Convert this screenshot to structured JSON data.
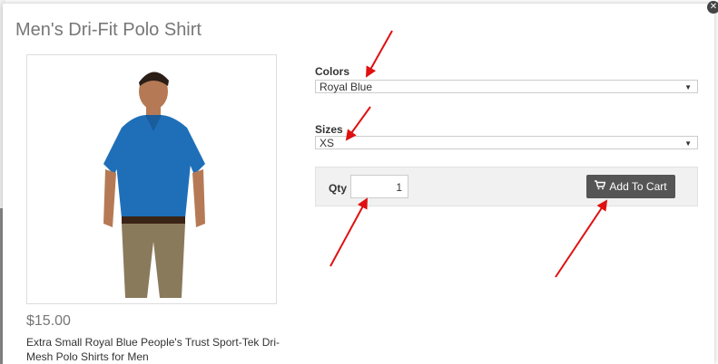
{
  "modal": {
    "title": "Men's Dri-Fit Polo Shirt",
    "close_icon": "close-icon"
  },
  "product": {
    "image_alt": "Men's Dri-Fit Polo Shirt photo",
    "price": "$15.00",
    "description": "Extra Small Royal Blue People's Trust Sport-Tek Dri-Mesh Polo Shirts for Men"
  },
  "options": {
    "colors_label": "Colors",
    "colors_value": "Royal Blue",
    "sizes_label": "Sizes",
    "sizes_value": "XS"
  },
  "cart": {
    "qty_label": "Qty",
    "qty_value": "1",
    "add_label": "Add To Cart",
    "cart_icon": "shopping-cart-icon"
  },
  "annotation": {
    "arrow_color": "#e01010"
  }
}
